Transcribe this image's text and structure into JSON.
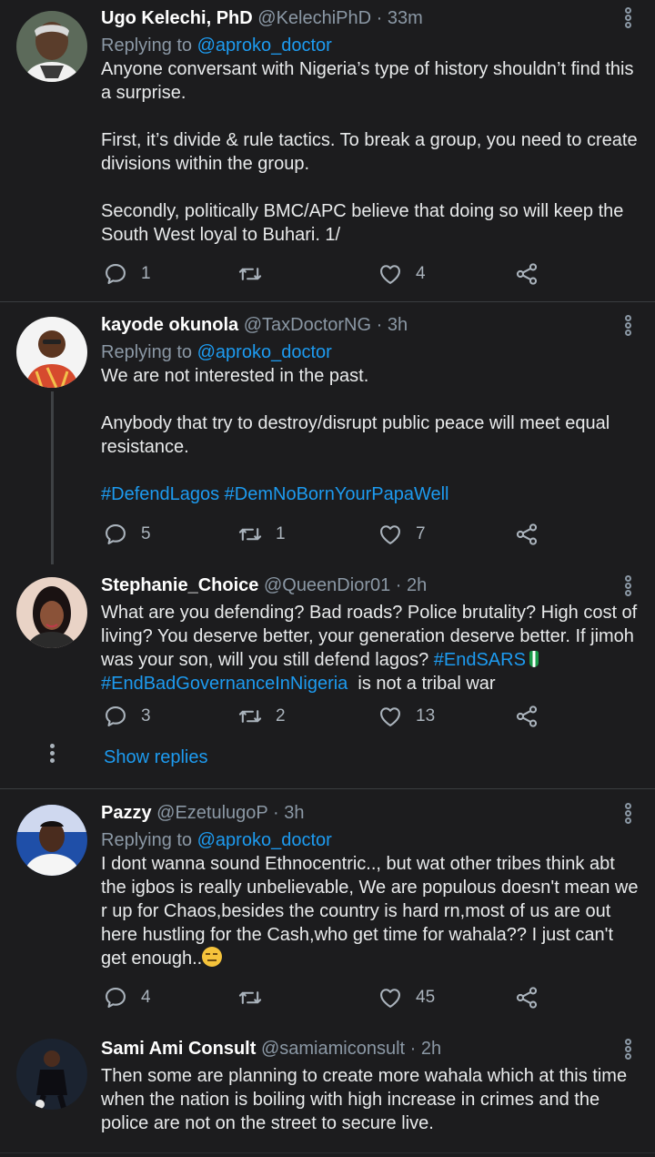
{
  "tweets": [
    {
      "name": "Ugo Kelechi, PhD",
      "handle": "@KelechiPhD",
      "time": "33m",
      "reply_label": "Replying to",
      "reply_to": "@aproko_doctor",
      "paragraphs": [
        "Anyone conversant with Nigeria’s type of history shouldn’t find this a surprise.",
        "First, it’s divide & rule tactics. To break a group, you need to create divisions within the group.",
        "Secondly, politically BMC/APC believe that doing so will keep the South West loyal to Buhari. 1/"
      ],
      "replies": "1",
      "retweets": "",
      "likes": "4"
    },
    {
      "name": "kayode okunola",
      "handle": "@TaxDoctorNG",
      "time": "3h",
      "reply_label": "Replying to",
      "reply_to": "@aproko_doctor",
      "paragraphs": [
        "We are not interested in the past.",
        "Anybody that try to destroy/disrupt public peace will meet equal resistance."
      ],
      "hashtags": "#DefendLagos #DemNoBornYourPapaWell",
      "replies": "5",
      "retweets": "1",
      "likes": "7"
    },
    {
      "name": "Stephanie_Choice",
      "handle": "@QueenDior01",
      "time": "2h",
      "text_main": "What are you defending? Bad roads? Police brutality? High cost of living? You deserve better, your generation deserve better. If jimoh was your son, will you still defend lagos?",
      "hashtag1": "#EndSARS",
      "hashtag2": "#EndBadGovernanceInNigeria",
      "text_tail": "is not a tribal war",
      "replies": "3",
      "retweets": "2",
      "likes": "13"
    },
    {
      "name": "Pazzy",
      "handle": "@EzetulugoP",
      "time": "3h",
      "reply_label": "Replying to",
      "reply_to": "@aproko_doctor",
      "text": "I dont wanna sound Ethnocentric.., but wat other tribes think abt the igbos is really unbelievable, We are populous doesn't mean we r up for Chaos,besides the country is hard rn,most of us are out here hustling for the Cash,who get time for wahala?? I just can't get enough..",
      "replies": "4",
      "retweets": "",
      "likes": "45"
    },
    {
      "name": "Sami Ami Consult",
      "handle": "@samiamiconsult",
      "time": "2h",
      "text": "Then some are planning to create more wahala which at this time when the nation is boiling with high increase in crimes and the police are not on the street to secure live."
    }
  ],
  "show_replies": "Show replies",
  "separator": "·",
  "colors": {
    "background": "#1c1c1e",
    "link": "#1d9bf0",
    "secondary_text": "#8b98a5",
    "divider": "#3a3d40"
  },
  "icons": [
    "reply-icon",
    "retweet-icon",
    "like-icon",
    "share-icon",
    "more-options-icon"
  ]
}
